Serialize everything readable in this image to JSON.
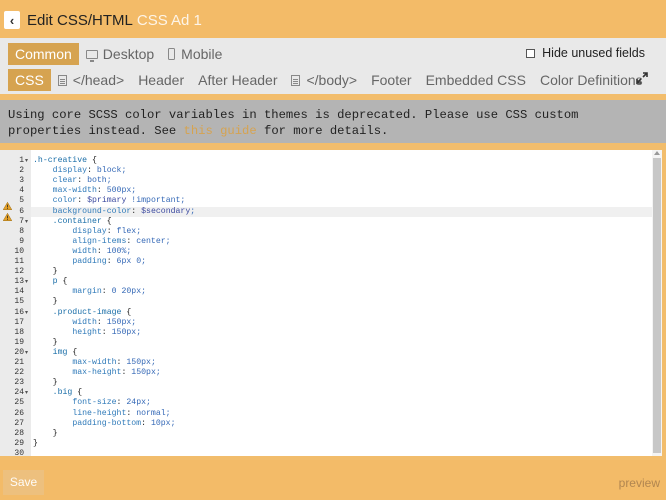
{
  "header": {
    "title": "Edit CSS/HTML",
    "subtitle": "CSS Ad 1"
  },
  "tabs_primary": [
    {
      "label": "Common",
      "active": true
    },
    {
      "label": "Desktop",
      "icon": "desktop-icon"
    },
    {
      "label": "Mobile",
      "icon": "mobile-icon"
    }
  ],
  "hide_unused": {
    "label": "Hide unused fields",
    "checked": false
  },
  "tabs_secondary": [
    {
      "label": "CSS",
      "active": true
    },
    {
      "label": "</head>",
      "icon": "document-icon"
    },
    {
      "label": "Header"
    },
    {
      "label": "After Header"
    },
    {
      "label": "</body>",
      "icon": "document-icon"
    },
    {
      "label": "Footer"
    },
    {
      "label": "Embedded CSS"
    },
    {
      "label": "Color Definitions"
    }
  ],
  "warning": {
    "text_before": "Using core SCSS color variables in themes is deprecated. Please use CSS custom properties instead. See",
    "link": "this guide",
    "text_after": "for more details."
  },
  "code_lines": [
    {
      "n": "1",
      "fold": true,
      "text": ".h-creative {"
    },
    {
      "n": "2",
      "text": "    display: block;"
    },
    {
      "n": "3",
      "text": "    clear: both;"
    },
    {
      "n": "4",
      "text": "    max-width: 500px;"
    },
    {
      "n": "5",
      "warn": true,
      "text": "    color: $primary !important;"
    },
    {
      "n": "6",
      "warn": true,
      "active": true,
      "text": "    background-color: $secondary;"
    },
    {
      "n": "7",
      "fold": true,
      "text": "    .container {"
    },
    {
      "n": "8",
      "text": "        display: flex;"
    },
    {
      "n": "9",
      "text": "        align-items: center;"
    },
    {
      "n": "10",
      "text": "        width: 100%;"
    },
    {
      "n": "11",
      "text": "        padding: 6px 0;"
    },
    {
      "n": "12",
      "text": "    }"
    },
    {
      "n": "13",
      "fold": true,
      "text": "    p {"
    },
    {
      "n": "14",
      "text": "        margin: 0 20px;"
    },
    {
      "n": "15",
      "text": "    }"
    },
    {
      "n": "16",
      "fold": true,
      "text": "    .product-image {"
    },
    {
      "n": "17",
      "text": "        width: 150px;"
    },
    {
      "n": "18",
      "text": "        height: 150px;"
    },
    {
      "n": "19",
      "text": "    }"
    },
    {
      "n": "20",
      "fold": true,
      "text": "    img {"
    },
    {
      "n": "21",
      "text": "        max-width: 150px;"
    },
    {
      "n": "22",
      "text": "        max-height: 150px;"
    },
    {
      "n": "23",
      "text": "    }"
    },
    {
      "n": "24",
      "fold": true,
      "text": "    .big {"
    },
    {
      "n": "25",
      "text": "        font-size: 24px;"
    },
    {
      "n": "26",
      "text": "        line-height: normal;"
    },
    {
      "n": "27",
      "text": "        padding-bottom: 10px;"
    },
    {
      "n": "28",
      "text": "    }"
    },
    {
      "n": "29",
      "text": "}"
    },
    {
      "n": "30",
      "text": ""
    }
  ],
  "footer": {
    "save_label": "Save",
    "preview_label": "preview"
  },
  "colors": {
    "accent": "#f3bb68",
    "active_tab": "#d6a350",
    "warning_bg": "#b4b4b4"
  }
}
